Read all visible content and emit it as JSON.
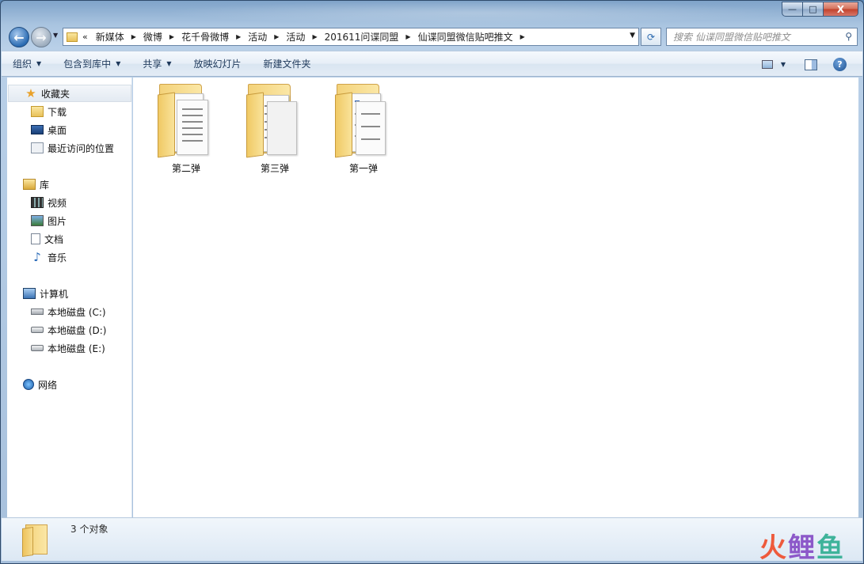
{
  "window": {
    "caption_buttons": {
      "minimize": "—",
      "maximize": "□",
      "close": "X"
    }
  },
  "address_bar": {
    "overflow": "«",
    "crumbs": [
      "新媒体",
      "微博",
      "花千骨微博",
      "活动",
      "活动",
      "201611问谍同盟",
      "仙谍同盟微信贴吧推文"
    ]
  },
  "search": {
    "placeholder": "搜索 仙谍同盟微信贴吧推文"
  },
  "command_bar": {
    "organize": "组织",
    "include_in_library": "包含到库中",
    "share": "共享",
    "slideshow": "放映幻灯片",
    "new_folder": "新建文件夹"
  },
  "nav": {
    "favorites": "收藏夹",
    "downloads": "下载",
    "desktop": "桌面",
    "recent": "最近访问的位置",
    "libraries": "库",
    "videos": "视频",
    "pictures": "图片",
    "documents": "文档",
    "music": "音乐",
    "computer": "计算机",
    "drive_c": "本地磁盘 (C:)",
    "drive_d": "本地磁盘 (D:)",
    "drive_e": "本地磁盘 (E:)",
    "network": "网络"
  },
  "folders": [
    {
      "name": "第二弹"
    },
    {
      "name": "第三弹"
    },
    {
      "name": "第一弹"
    }
  ],
  "details": {
    "count_text": "3 个对象"
  },
  "watermark": {
    "part1": "火",
    "part2": "鲤",
    "part3": "鱼"
  }
}
